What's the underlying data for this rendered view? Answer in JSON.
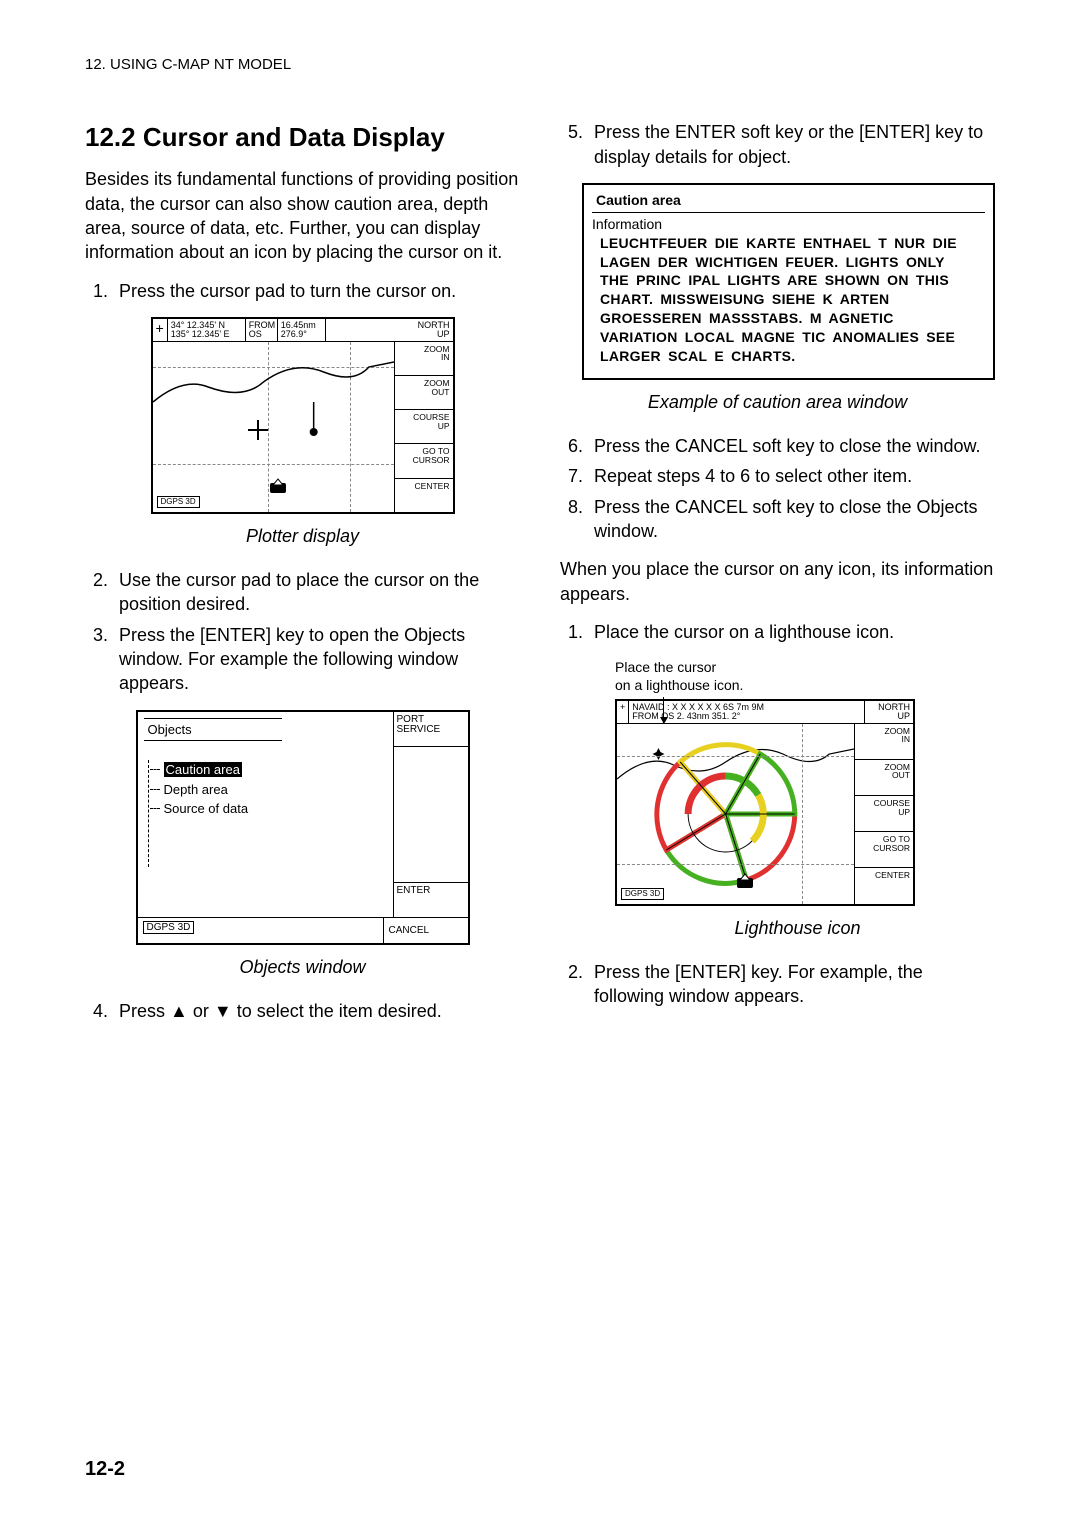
{
  "running_head": "12. USING C-MAP NT MODEL",
  "page_number": "12-2",
  "left": {
    "section_title": "12.2   Cursor and Data Display",
    "intro": "Besides its fundamental functions of providing position data, the cursor can also show caution area, depth area, source of data, etc. Further, you can display information about an icon by placing the cursor on it.",
    "step1": "Press the cursor pad to turn the cursor on.",
    "fig1_caption": "Plotter display",
    "step2": "Use the cursor pad to place the cursor on the position desired.",
    "step3": "Press the [ENTER] key to open the Objects window. For example the following window appears.",
    "fig2_caption": "Objects window",
    "step4_pre": "Press ",
    "step4_post": " to select the item desired.",
    "step4_mid": " or "
  },
  "right": {
    "step5": "Press the ENTER soft key or the [ENTER] key to display details for object.",
    "caution_title": "Caution area",
    "caution_sub": "Information",
    "caution_msg": "LEUCHTFEUER DIE KARTE ENTHAEL T NUR DIE LAGEN DER WICHTIGEN FEUER. LIGHTS ONLY THE PRINC IPAL LIGHTS ARE SHOWN ON THIS CHART. MISSWEISUNG SIEHE K ARTEN GROESSEREN MASSSTABS. M AGNETIC VARIATION LOCAL MAGNE TIC ANOMALIES SEE LARGER SCAL E CHARTS.",
    "fig3_caption": "Example of caution area window",
    "step6": "Press the CANCEL soft key to close the window.",
    "step7": "Repeat steps 4 to 6 to select other item.",
    "step8": "Press the CANCEL soft key to close the Objects window.",
    "para2": "When you place the cursor on any icon, its information appears.",
    "lh_step1": "Place the cursor on a lighthouse icon.",
    "lh_note": "Place the cursor\non a lighthouse icon.",
    "fig4_caption": "Lighthouse icon",
    "lh_step2": "Press the [ENTER] key. For example, the following window appears."
  },
  "plotter": {
    "lat": "34° 12.345' N",
    "lon": "135° 12.345' E",
    "from_os": "FROM\nOS",
    "rng": "16.45nm",
    "brg": "276.9°",
    "north_up": "NORTH\nUP",
    "keys": {
      "zoom_in": "ZOOM\nIN",
      "zoom_out": "ZOOM\nOUT",
      "course_up": "COURSE\nUP",
      "goto_cursor": "GO TO\nCURSOR",
      "center": "CENTER"
    },
    "dgps": "DGPS 3D"
  },
  "objwin": {
    "title": "Objects",
    "items": {
      "caution": "Caution area",
      "depth": "Depth area",
      "source": "Source of data"
    },
    "keys": {
      "port_service": "PORT\nSERVICE",
      "enter": "ENTER",
      "cancel": "CANCEL"
    },
    "dgps": "DGPS 3D"
  },
  "plotter2": {
    "navaid_line": "NAVAID : X X X X X X   6S  7m  9M",
    "from_line": "FROM  OS     2. 43nm        351. 2°",
    "north_up": "NORTH\nUP",
    "dgps": "DGPS 3D"
  }
}
